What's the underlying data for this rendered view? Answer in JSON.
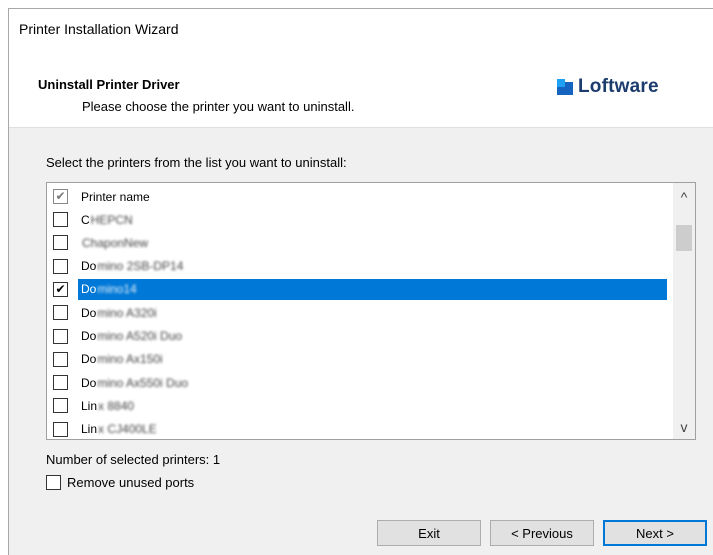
{
  "window": {
    "title": "Printer Installation Wizard"
  },
  "header": {
    "title": "Uninstall Printer Driver",
    "subtitle": "Please choose the printer you want to uninstall.",
    "logo_text": "Loftware"
  },
  "prompt": "Select the printers from the list you want to uninstall:",
  "list": {
    "header": {
      "label": "Printer name",
      "checked": true
    },
    "rows": [
      {
        "prefix": "C",
        "obscured": "HEPCN",
        "checked": false,
        "selected": false
      },
      {
        "prefix": "",
        "obscured": "ChaponNew",
        "checked": false,
        "selected": false
      },
      {
        "prefix": "Do",
        "obscured": "mino 2SB-DP14",
        "checked": false,
        "selected": false
      },
      {
        "prefix": "Do",
        "obscured": "mino14",
        "checked": true,
        "selected": true
      },
      {
        "prefix": "Do",
        "obscured": "mino A320i",
        "checked": false,
        "selected": false
      },
      {
        "prefix": "Do",
        "obscured": "mino A520i Duo",
        "checked": false,
        "selected": false
      },
      {
        "prefix": "Do",
        "obscured": "mino Ax150i",
        "checked": false,
        "selected": false
      },
      {
        "prefix": "Do",
        "obscured": "mino Ax550i Duo",
        "checked": false,
        "selected": false
      },
      {
        "prefix": "Lin",
        "obscured": "x 8840",
        "checked": false,
        "selected": false
      },
      {
        "prefix": "Lin",
        "obscured": "x CJ400LE",
        "checked": false,
        "selected": false
      }
    ]
  },
  "status": {
    "selected_count_text": "Number of selected printers: 1"
  },
  "options": {
    "remove_ports_label": "Remove unused ports",
    "remove_ports_checked": false
  },
  "buttons": {
    "exit": "Exit",
    "previous": "< Previous",
    "next": "Next >"
  },
  "icons": {
    "check": "✔",
    "scroll_up": "^",
    "scroll_down": "v"
  },
  "colors": {
    "selection": "#0078d7",
    "logo_text": "#1c3c6e",
    "logo_light": "#1ea1f2",
    "logo_dark": "#1565c0"
  }
}
